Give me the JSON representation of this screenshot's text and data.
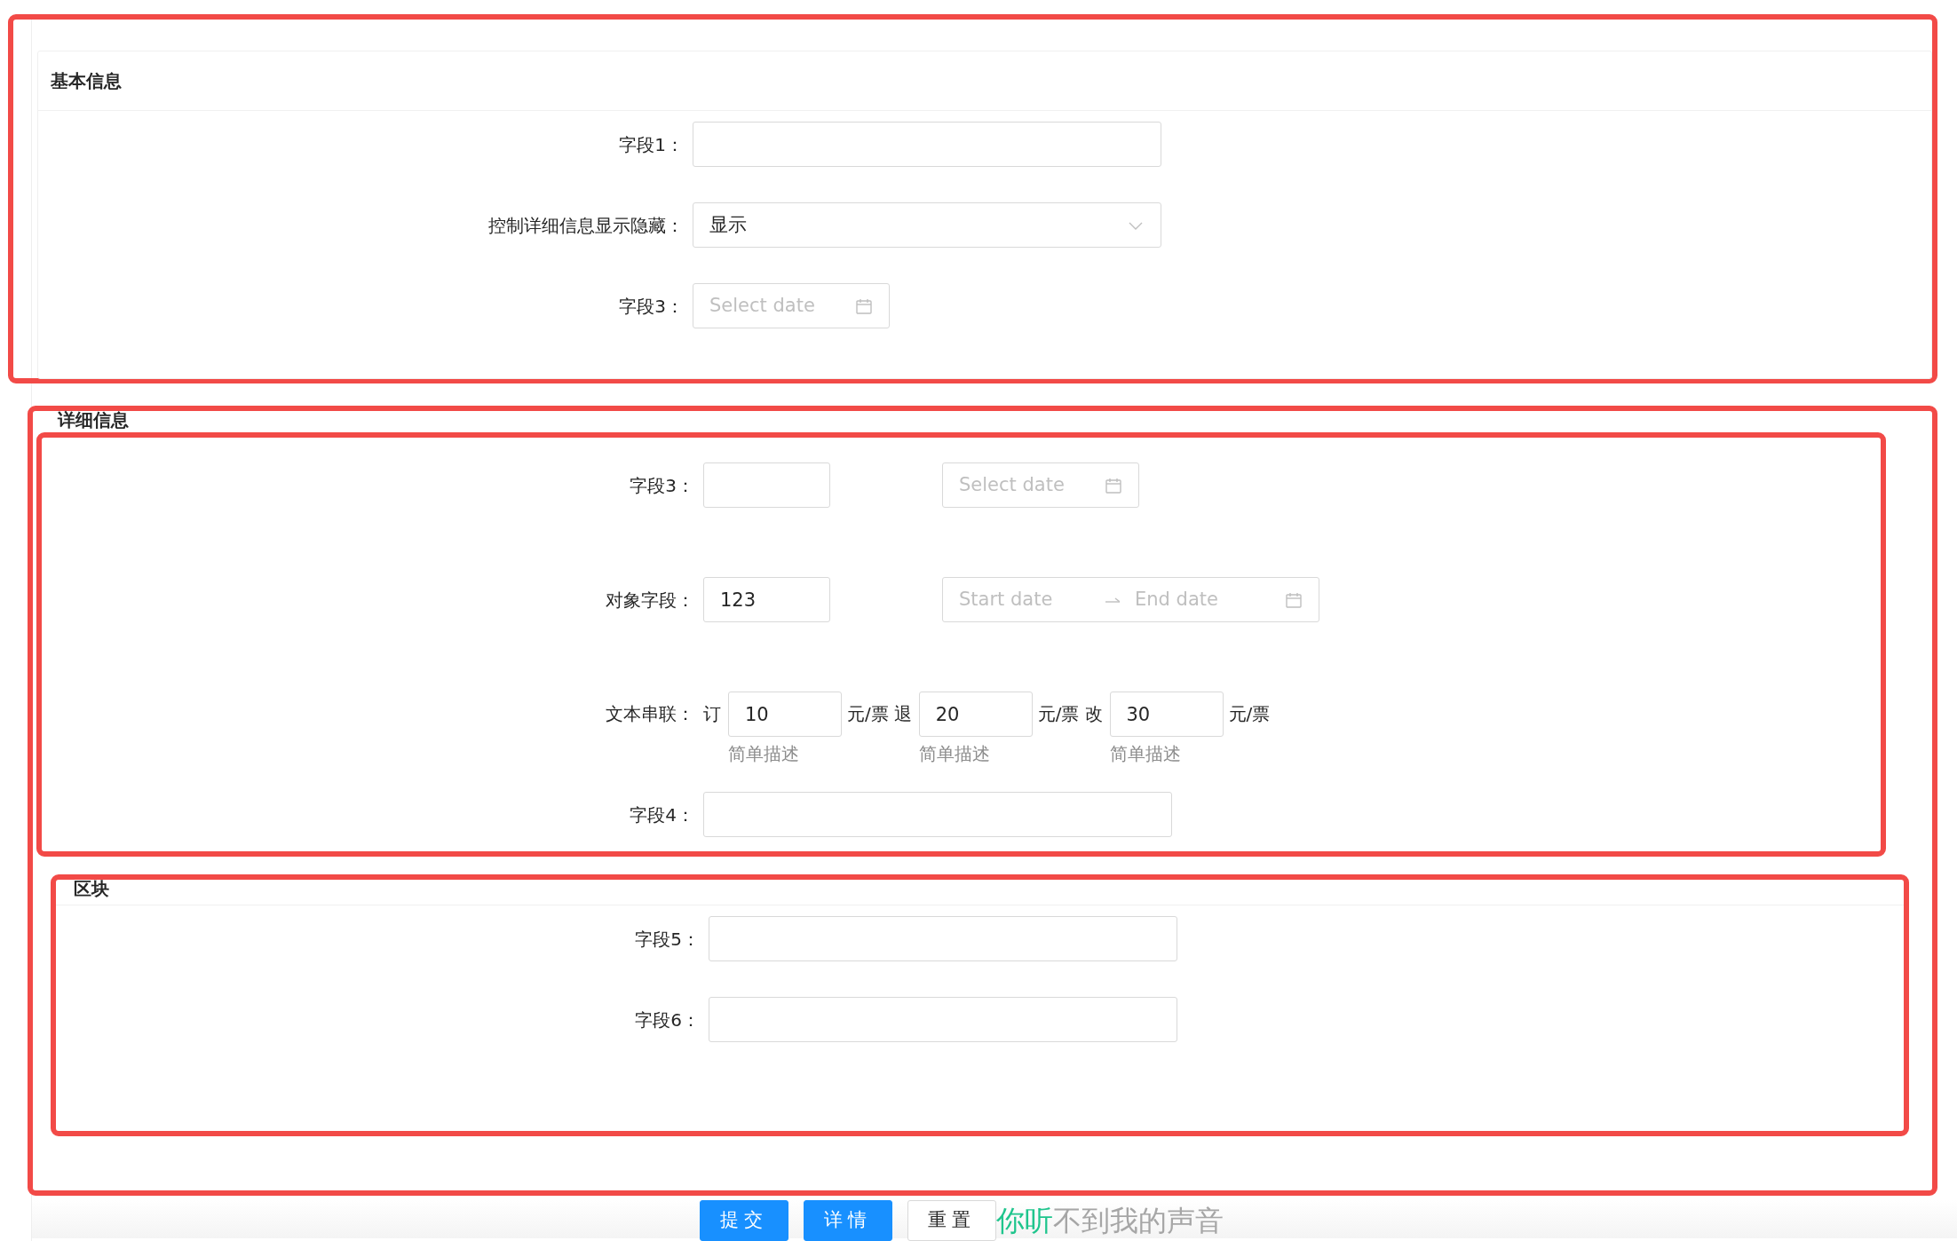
{
  "basic": {
    "title": "基本信息",
    "fields": [
      {
        "kind": "text",
        "label": "字段1："
      },
      {
        "kind": "select",
        "label": "控制详细信息显示隐藏：",
        "value": "显示"
      },
      {
        "kind": "date",
        "label": "字段3：",
        "placeholder": "Select date"
      }
    ]
  },
  "details": {
    "title": "详细信息",
    "fields": [
      {
        "kind": "text-date",
        "label": "字段3：",
        "date_placeholder": "Select date"
      },
      {
        "kind": "text-range",
        "label": "对象字段：",
        "value": "123",
        "start_placeholder": "Start date",
        "end_placeholder": "End date"
      },
      {
        "kind": "concat",
        "label": "文本串联：",
        "parts": [
          {
            "prefix": "订",
            "value": "10",
            "suffix": "元/票",
            "help": "简单描述"
          },
          {
            "prefix": "退",
            "value": "20",
            "suffix": "元/票",
            "help": "简单描述"
          },
          {
            "prefix": "改",
            "value": "30",
            "suffix": "元/票",
            "help": "简单描述"
          }
        ]
      },
      {
        "kind": "text",
        "label": "字段4："
      }
    ],
    "block": {
      "title": "区块",
      "fields": [
        {
          "kind": "text",
          "label": "字段5："
        },
        {
          "kind": "text",
          "label": "字段6："
        }
      ]
    }
  },
  "buttons": [
    {
      "label": "提交",
      "kind": "primary"
    },
    {
      "label": "详情",
      "kind": "primary"
    },
    {
      "label": "重置",
      "kind": "default"
    }
  ],
  "lyric": {
    "sung": "你听",
    "unsung": "不到我的声音"
  }
}
